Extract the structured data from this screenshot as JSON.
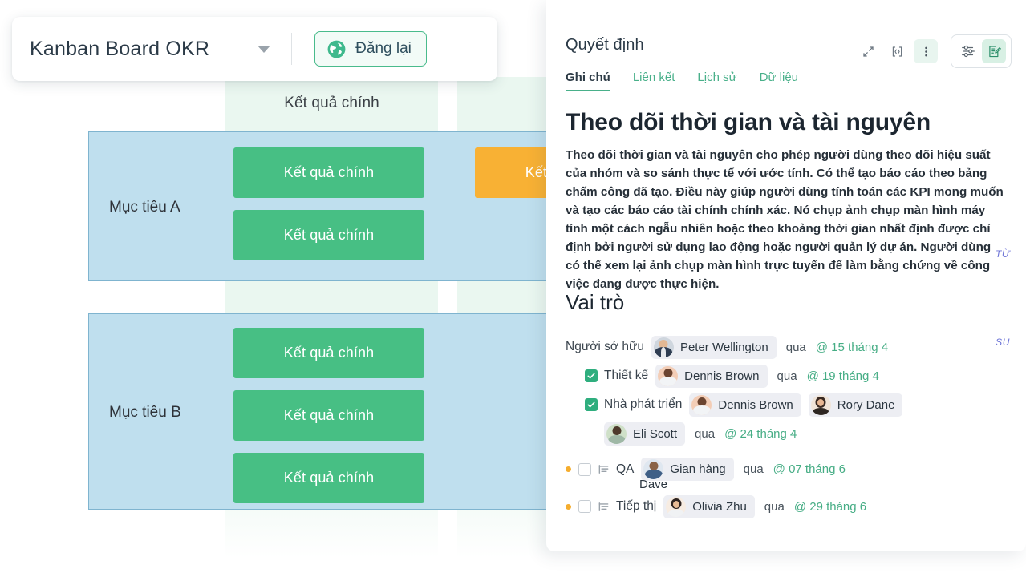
{
  "toolbar": {
    "board_title": "Kanban Board OKR",
    "dropdown_icon": "chevron-down-icon",
    "publish_label": "Đăng lại",
    "publish_icon": "globe-icon"
  },
  "board": {
    "column_title": "Kết quả chính",
    "objectives": [
      {
        "label": "Mục tiêu A",
        "cards": [
          {
            "label": "Kết quả chính",
            "color": "#47bf84",
            "status": "green"
          },
          {
            "label": "Kết quả chính",
            "color": "#47bf84",
            "status": "green"
          },
          {
            "label": "Kết quả chính",
            "color": "#f8b134",
            "status": "orange"
          }
        ]
      },
      {
        "label": "Mục tiêu B",
        "cards": [
          {
            "label": "Kết quả chính",
            "color": "#47bf84",
            "status": "green"
          },
          {
            "label": "Kết quả chính",
            "color": "#47bf84",
            "status": "green"
          },
          {
            "label": "Kết quả chính",
            "color": "#47bf84",
            "status": "green"
          }
        ]
      }
    ],
    "colors": {
      "column_band": "#eaf7f0",
      "objective_row": "#bfdfee",
      "objective_border": "#7fb4cf",
      "card_green": "#47bf84",
      "card_orange": "#f8b134"
    }
  },
  "panel": {
    "title": "Quyết định",
    "head_icons": [
      {
        "name": "expand-arrows-icon",
        "tinted": false
      },
      {
        "name": "code-brackets-icon",
        "tinted": false
      },
      {
        "name": "kebab-menu-icon",
        "tinted": true
      }
    ],
    "group_icons": [
      {
        "name": "sliders-icon",
        "active": false
      },
      {
        "name": "edit-document-icon",
        "active": true
      }
    ],
    "tabs": [
      {
        "label": "Ghi chú",
        "active": true
      },
      {
        "label": "Liên kết",
        "active": false
      },
      {
        "label": "Lịch sử",
        "active": false
      },
      {
        "label": "Dữ liệu",
        "active": false
      }
    ],
    "doc_title": "Theo dõi thời gian và tài nguyên",
    "doc_body": "Theo dõi thời gian và tài nguyên cho phép người dùng theo dõi hiệu suất của nhóm và so sánh thực tế với ước tính. Có thể tạo báo cáo theo bảng chấm công đã tạo. Điều này giúp người dùng tính toán các KPI mong muốn và tạo các báo cáo tài chính chính xác. Nó chụp ảnh chụp màn hình máy tính một cách ngẫu nhiên hoặc theo khoảng thời gian nhất định được chỉ định bởi người sử dụng lao động hoặc người quản lý dự án. Người dùng có thể xem lại ảnh chụp màn hình trực tuyến để làm bằng chứng về công việc đang được thực hiện.",
    "section_heading": "Vai trò",
    "mini_tags": {
      "tu": "TỪ",
      "su": "SU"
    },
    "via_label": "qua",
    "roles": [
      {
        "label": "Người sở hữu",
        "marker": "none",
        "people": [
          {
            "name": "Peter Wellington",
            "avatar": "peter-wellington-avatar"
          }
        ],
        "date": "@ 15 tháng 4"
      },
      {
        "label": "Thiết kế",
        "marker": "checked",
        "people": [
          {
            "name": "Dennis Brown",
            "avatar": "dennis-brown-avatar"
          }
        ],
        "date": "@ 19 tháng 4"
      },
      {
        "label": "Nhà phát triển",
        "marker": "checked",
        "people": [
          {
            "name": "Dennis Brown",
            "avatar": "dennis-brown-avatar"
          },
          {
            "name": "Rory Dane",
            "avatar": "rory-dane-avatar"
          },
          {
            "name": "Eli Scott",
            "avatar": "eli-scott-avatar"
          }
        ],
        "date": "@ 24 tháng 4"
      },
      {
        "label": "QA",
        "marker": "unchecked",
        "people": [
          {
            "name": "Gian hàng",
            "name2": "Dave",
            "avatar": "gian-hang-dave-avatar"
          }
        ],
        "date": "@ 07 tháng 6"
      },
      {
        "label": "Tiếp thị",
        "marker": "unchecked",
        "people": [
          {
            "name": "Olivia Zhu",
            "avatar": "olivia-zhu-avatar"
          }
        ],
        "date": "@ 29 tháng 6"
      }
    ]
  }
}
